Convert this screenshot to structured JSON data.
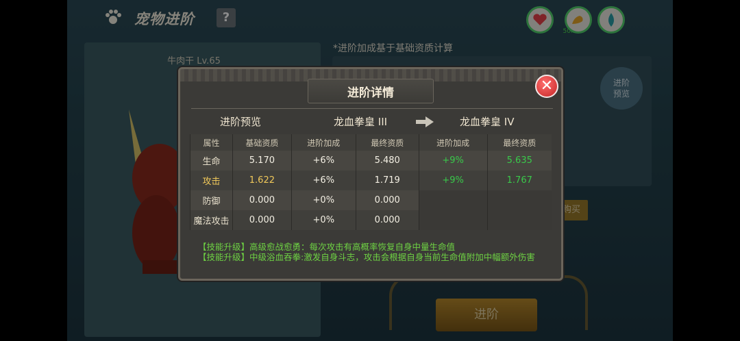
{
  "header": {
    "title": "宠物进阶",
    "help": "?"
  },
  "hud": {
    "ping": "50ms"
  },
  "background": {
    "pet_name": "牛肉干 Lv.65",
    "note": "*进阶加成基于基础资质计算",
    "preview_button": "进阶\n预览",
    "buy_button": "购买",
    "advance_button": "进阶"
  },
  "modal": {
    "title": "进阶详情",
    "preview_label": "进阶预览",
    "from_stage": "龙血拳皇 III",
    "to_stage": "龙血拳皇 IV",
    "columns": [
      "属性",
      "基础资质",
      "进阶加成",
      "最终资质",
      "进阶加成",
      "最终资质"
    ],
    "rows": [
      {
        "attr": "生命",
        "base": "5.170",
        "bonus": "+6%",
        "final": "5.480",
        "next_bonus": "+9%",
        "next_final": "5.635"
      },
      {
        "attr": "攻击",
        "base": "1.622",
        "bonus": "+6%",
        "final": "1.719",
        "next_bonus": "+9%",
        "next_final": "1.767"
      },
      {
        "attr": "防御",
        "base": "0.000",
        "bonus": "+0%",
        "final": "0.000",
        "next_bonus": "",
        "next_final": ""
      },
      {
        "attr": "魔法攻击",
        "base": "0.000",
        "bonus": "+0%",
        "final": "0.000",
        "next_bonus": "",
        "next_final": ""
      }
    ],
    "skills": [
      "【技能升级】高级愈战愈勇：每次攻击有高概率恢复自身中量生命值",
      "【技能升级】中级浴血吞拳:激发自身斗志，攻击会根据自身当前生命值附加中幅额外伤害"
    ]
  }
}
